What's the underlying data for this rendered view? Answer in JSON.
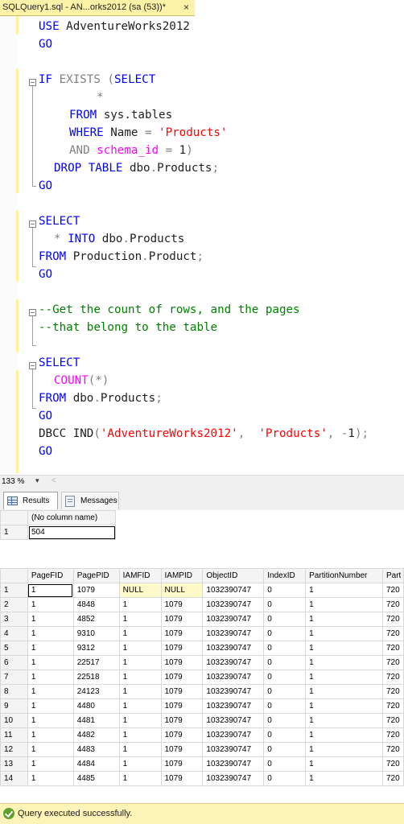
{
  "tab": {
    "title": "SQLQuery1.sql - AN...orks2012 (sa (53))*",
    "close": "×"
  },
  "editor": {
    "lines": {
      "l1": {
        "a": "USE",
        "b": " AdventureWorks2012"
      },
      "l2": {
        "a": "GO"
      },
      "l4": {
        "a": "IF",
        "b": " EXISTS",
        "c": " (",
        "d": "SELECT"
      },
      "l5": {
        "a": "*"
      },
      "l6": {
        "a": "FROM",
        "b": " sys.tables"
      },
      "l7": {
        "a": "WHERE",
        "b": " Name ",
        "c": "=",
        "d": " 'Products'"
      },
      "l8": {
        "a": "AND",
        "b": " schema_id",
        "c": " =",
        "d": " 1",
        "e": ")"
      },
      "l9": {
        "a": "DROP",
        "b": " TABLE",
        "c": " dbo",
        "d": ".",
        "e": "Products",
        "f": ";"
      },
      "l10": {
        "a": "GO"
      },
      "l12": {
        "a": "SELECT"
      },
      "l13": {
        "a": "*",
        "b": " INTO",
        "c": " dbo",
        "d": ".",
        "e": "Products"
      },
      "l14": {
        "a": "FROM",
        "b": " Production",
        "c": ".",
        "d": "Product",
        "e": ";"
      },
      "l15": {
        "a": "GO"
      },
      "l17": {
        "a": "--Get the count of rows, and the pages"
      },
      "l18": {
        "a": "--that belong to the table"
      },
      "l20": {
        "a": "SELECT"
      },
      "l21": {
        "a": "COUNT",
        "b": "(*)"
      },
      "l22": {
        "a": "FROM",
        "b": " dbo",
        "c": ".",
        "d": "Products",
        "e": ";"
      },
      "l23": {
        "a": "GO"
      },
      "l24": {
        "a": "DBCC",
        "b": " IND",
        "c": "(",
        "d": "'AdventureWorks2012'",
        "e": ",  ",
        "f": "'Products'",
        "g": ", ",
        "h": "-",
        "i": "1",
        "j": ");"
      },
      "l25": {
        "a": "GO"
      }
    }
  },
  "zoom": {
    "value": "133 %",
    "dropdown": "▾",
    "scroll_left": "<"
  },
  "result_tabs": {
    "results": "Results",
    "messages": "Messages"
  },
  "result1": {
    "header": "(No column name)",
    "rows": [
      {
        "n": "1",
        "v": "504"
      }
    ]
  },
  "result2": {
    "columns": [
      "PageFID",
      "PagePID",
      "IAMFID",
      "IAMPID",
      "ObjectID",
      "IndexID",
      "PartitionNumber",
      "Part"
    ],
    "rows": [
      [
        "1",
        "1",
        "1079",
        "NULL",
        "NULL",
        "1032390747",
        "0",
        "1",
        "720"
      ],
      [
        "2",
        "1",
        "4848",
        "1",
        "1079",
        "1032390747",
        "0",
        "1",
        "720"
      ],
      [
        "3",
        "1",
        "4852",
        "1",
        "1079",
        "1032390747",
        "0",
        "1",
        "720"
      ],
      [
        "4",
        "1",
        "9310",
        "1",
        "1079",
        "1032390747",
        "0",
        "1",
        "720"
      ],
      [
        "5",
        "1",
        "9312",
        "1",
        "1079",
        "1032390747",
        "0",
        "1",
        "720"
      ],
      [
        "6",
        "1",
        "22517",
        "1",
        "1079",
        "1032390747",
        "0",
        "1",
        "720"
      ],
      [
        "7",
        "1",
        "22518",
        "1",
        "1079",
        "1032390747",
        "0",
        "1",
        "720"
      ],
      [
        "8",
        "1",
        "24123",
        "1",
        "1079",
        "1032390747",
        "0",
        "1",
        "720"
      ],
      [
        "9",
        "1",
        "4480",
        "1",
        "1079",
        "1032390747",
        "0",
        "1",
        "720"
      ],
      [
        "10",
        "1",
        "4481",
        "1",
        "1079",
        "1032390747",
        "0",
        "1",
        "720"
      ],
      [
        "11",
        "1",
        "4482",
        "1",
        "1079",
        "1032390747",
        "0",
        "1",
        "720"
      ],
      [
        "12",
        "1",
        "4483",
        "1",
        "1079",
        "1032390747",
        "0",
        "1",
        "720"
      ],
      [
        "13",
        "1",
        "4484",
        "1",
        "1079",
        "1032390747",
        "0",
        "1",
        "720"
      ],
      [
        "14",
        "1",
        "4485",
        "1",
        "1079",
        "1032390747",
        "0",
        "1",
        "720"
      ]
    ]
  },
  "status": {
    "text": "Query executed successfully."
  }
}
